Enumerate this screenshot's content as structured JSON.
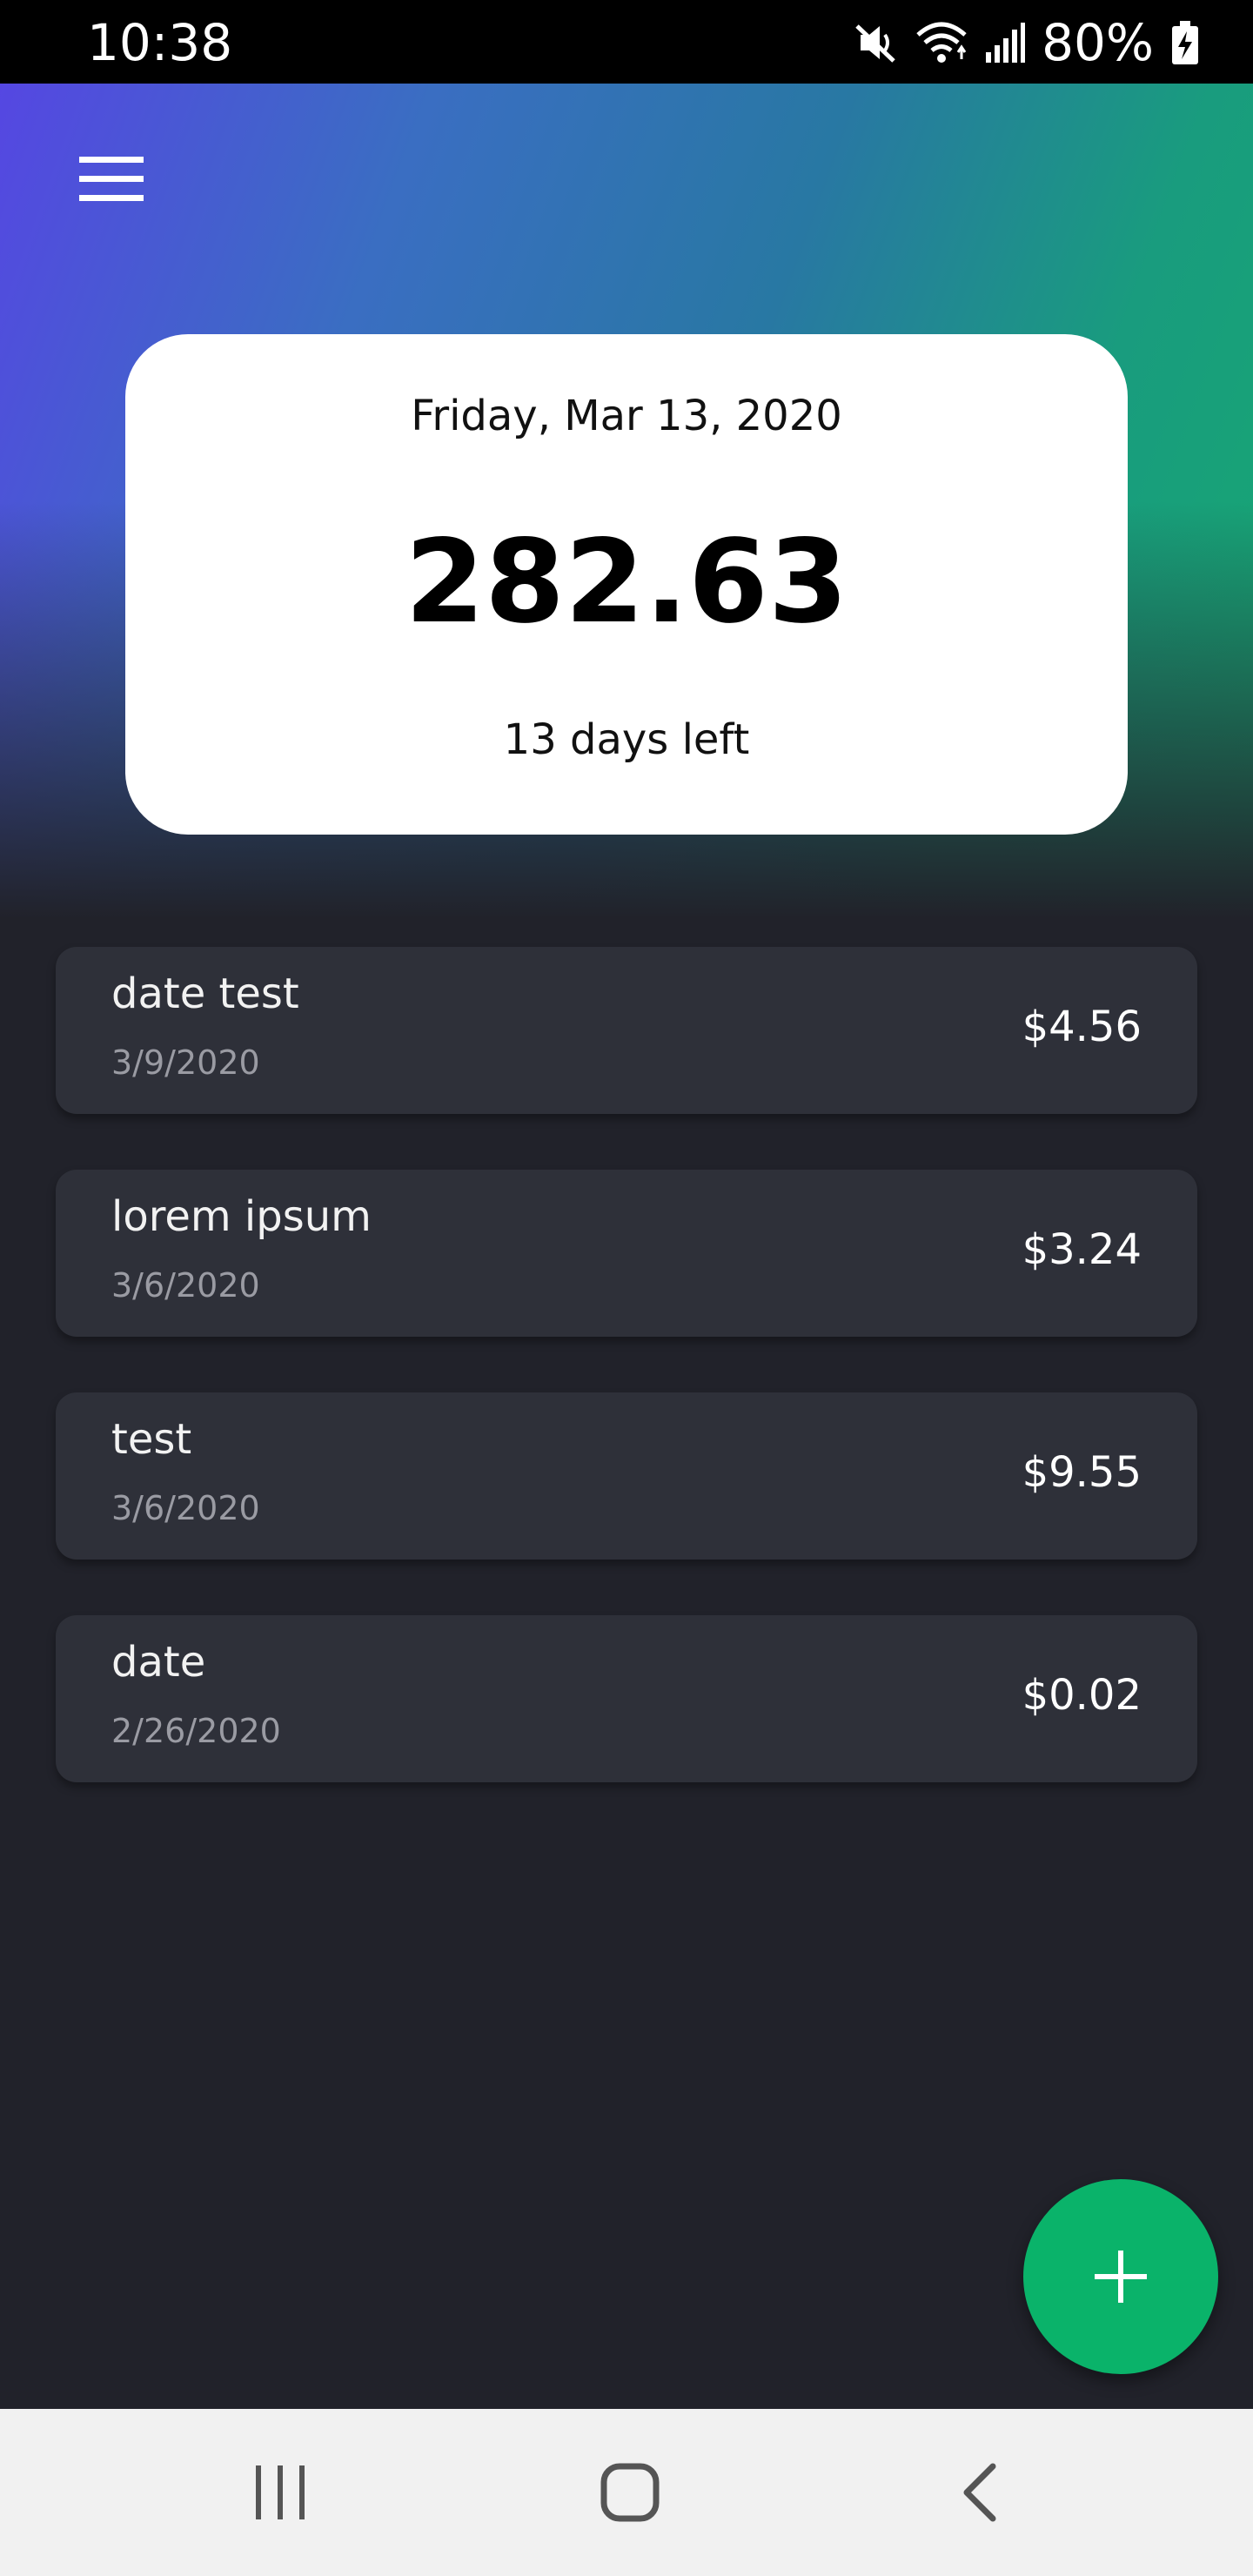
{
  "status_bar": {
    "time": "10:38",
    "battery_percent": "80%",
    "icons": [
      "mute-icon",
      "wifi-icon",
      "signal-icon",
      "battery-charging-icon"
    ]
  },
  "header": {
    "menu_icon": "hamburger-menu-icon",
    "gradient_colors": [
      "#5547e2",
      "#2878a3",
      "#16a872"
    ]
  },
  "budget_card": {
    "date": "Friday, Mar 13, 2020",
    "amount": "282.63",
    "days_left": "13 days left"
  },
  "transactions": [
    {
      "name": "date test",
      "date": "3/9/2020",
      "amount": "$4.56"
    },
    {
      "name": "lorem ipsum",
      "date": "3/6/2020",
      "amount": "$3.24"
    },
    {
      "name": "test",
      "date": "3/6/2020",
      "amount": "$9.55"
    },
    {
      "name": "date",
      "date": "2/26/2020",
      "amount": "$0.02"
    }
  ],
  "fab": {
    "icon": "plus-icon",
    "color": "#0ab36a"
  },
  "nav_bar": {
    "buttons": [
      "recent-apps-icon",
      "home-icon",
      "back-icon"
    ]
  }
}
